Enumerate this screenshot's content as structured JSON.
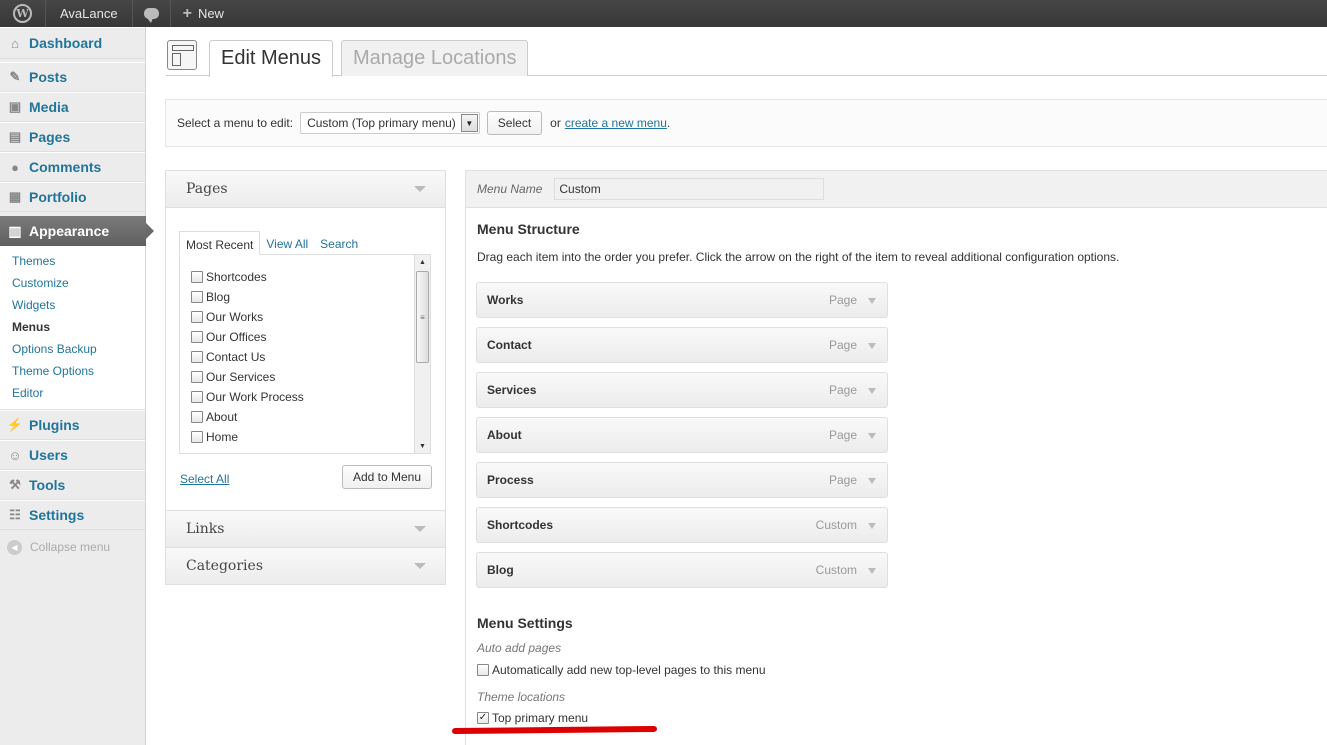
{
  "adminbar": {
    "site_name": "AvaLance",
    "new_label": "New"
  },
  "sidebar": {
    "items_top": [
      {
        "label": "Dashboard",
        "icon": "home-icon"
      },
      {
        "label": "Posts",
        "icon": "pin-icon"
      },
      {
        "label": "Media",
        "icon": "media-icon"
      },
      {
        "label": "Pages",
        "icon": "pages-icon"
      },
      {
        "label": "Comments",
        "icon": "comment-icon"
      },
      {
        "label": "Portfolio",
        "icon": "portfolio-icon"
      }
    ],
    "appearance": "Appearance",
    "submenu": [
      "Themes",
      "Customize",
      "Widgets",
      "Menus",
      "Options Backup",
      "Theme Options",
      "Editor"
    ],
    "items_bottom": [
      {
        "label": "Plugins",
        "icon": "plug-icon"
      },
      {
        "label": "Users",
        "icon": "users-icon"
      },
      {
        "label": "Tools",
        "icon": "tools-icon"
      },
      {
        "label": "Settings",
        "icon": "settings-icon"
      }
    ],
    "collapse": "Collapse menu"
  },
  "tabs": {
    "edit": "Edit Menus",
    "manage": "Manage Locations"
  },
  "manage": {
    "label": "Select a menu to edit:",
    "selected": "Custom (Top primary menu)",
    "select_button": "Select",
    "or": "or",
    "create_link": "create a new menu",
    "period": "."
  },
  "pages_box": {
    "title": "Pages",
    "tabs": [
      "Most Recent",
      "View All",
      "Search"
    ],
    "items": [
      "Shortcodes",
      "Blog",
      "Our Works",
      "Our Offices",
      "Contact Us",
      "Our Services",
      "Our Work Process",
      "About",
      "Home"
    ],
    "select_all": "Select All",
    "add_button": "Add to Menu"
  },
  "links_title": "Links",
  "categories_title": "Categories",
  "editor": {
    "name_label": "Menu Name",
    "name_value": "Custom",
    "structure_title": "Menu Structure",
    "structure_desc": "Drag each item into the order you prefer. Click the arrow on the right of the item to reveal additional configuration options.",
    "items": [
      {
        "title": "Works",
        "type": "Page"
      },
      {
        "title": "Contact",
        "type": "Page"
      },
      {
        "title": "Services",
        "type": "Page"
      },
      {
        "title": "About",
        "type": "Page"
      },
      {
        "title": "Process",
        "type": "Page"
      },
      {
        "title": "Shortcodes",
        "type": "Custom"
      },
      {
        "title": "Blog",
        "type": "Custom"
      }
    ],
    "settings_title": "Menu Settings",
    "auto_add_label": "Auto add pages",
    "auto_add_text": "Automatically add new top-level pages to this menu",
    "auto_add_checked": false,
    "locations_label": "Theme locations",
    "location_text": "Top primary menu",
    "location_checked": true
  },
  "annotation_color": "#dd0000"
}
